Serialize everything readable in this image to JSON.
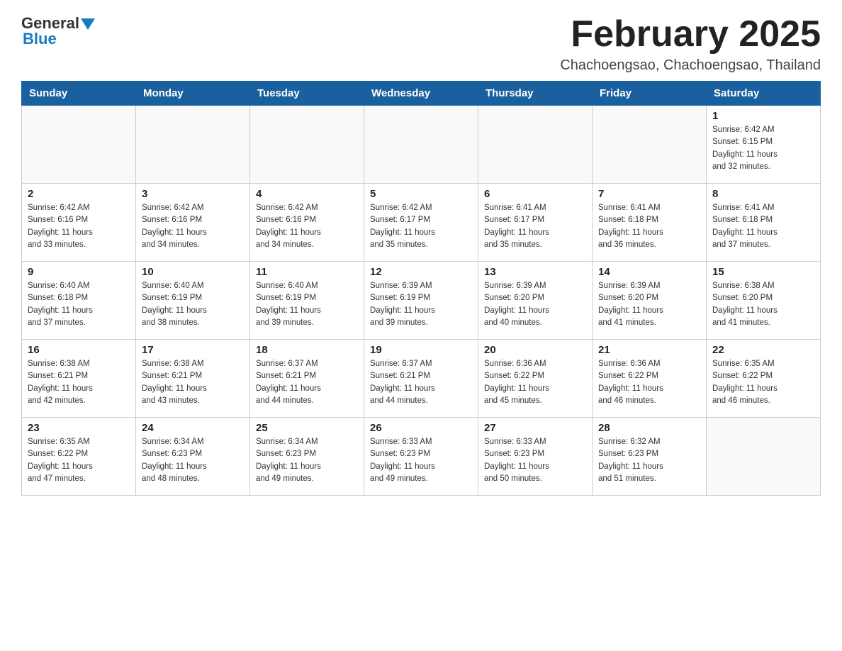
{
  "header": {
    "logo_general": "General",
    "logo_blue": "Blue",
    "month_title": "February 2025",
    "location": "Chachoengsao, Chachoengsao, Thailand"
  },
  "days_of_week": [
    "Sunday",
    "Monday",
    "Tuesday",
    "Wednesday",
    "Thursday",
    "Friday",
    "Saturday"
  ],
  "weeks": [
    [
      {
        "day": "",
        "info": ""
      },
      {
        "day": "",
        "info": ""
      },
      {
        "day": "",
        "info": ""
      },
      {
        "day": "",
        "info": ""
      },
      {
        "day": "",
        "info": ""
      },
      {
        "day": "",
        "info": ""
      },
      {
        "day": "1",
        "info": "Sunrise: 6:42 AM\nSunset: 6:15 PM\nDaylight: 11 hours\nand 32 minutes."
      }
    ],
    [
      {
        "day": "2",
        "info": "Sunrise: 6:42 AM\nSunset: 6:16 PM\nDaylight: 11 hours\nand 33 minutes."
      },
      {
        "day": "3",
        "info": "Sunrise: 6:42 AM\nSunset: 6:16 PM\nDaylight: 11 hours\nand 34 minutes."
      },
      {
        "day": "4",
        "info": "Sunrise: 6:42 AM\nSunset: 6:16 PM\nDaylight: 11 hours\nand 34 minutes."
      },
      {
        "day": "5",
        "info": "Sunrise: 6:42 AM\nSunset: 6:17 PM\nDaylight: 11 hours\nand 35 minutes."
      },
      {
        "day": "6",
        "info": "Sunrise: 6:41 AM\nSunset: 6:17 PM\nDaylight: 11 hours\nand 35 minutes."
      },
      {
        "day": "7",
        "info": "Sunrise: 6:41 AM\nSunset: 6:18 PM\nDaylight: 11 hours\nand 36 minutes."
      },
      {
        "day": "8",
        "info": "Sunrise: 6:41 AM\nSunset: 6:18 PM\nDaylight: 11 hours\nand 37 minutes."
      }
    ],
    [
      {
        "day": "9",
        "info": "Sunrise: 6:40 AM\nSunset: 6:18 PM\nDaylight: 11 hours\nand 37 minutes."
      },
      {
        "day": "10",
        "info": "Sunrise: 6:40 AM\nSunset: 6:19 PM\nDaylight: 11 hours\nand 38 minutes."
      },
      {
        "day": "11",
        "info": "Sunrise: 6:40 AM\nSunset: 6:19 PM\nDaylight: 11 hours\nand 39 minutes."
      },
      {
        "day": "12",
        "info": "Sunrise: 6:39 AM\nSunset: 6:19 PM\nDaylight: 11 hours\nand 39 minutes."
      },
      {
        "day": "13",
        "info": "Sunrise: 6:39 AM\nSunset: 6:20 PM\nDaylight: 11 hours\nand 40 minutes."
      },
      {
        "day": "14",
        "info": "Sunrise: 6:39 AM\nSunset: 6:20 PM\nDaylight: 11 hours\nand 41 minutes."
      },
      {
        "day": "15",
        "info": "Sunrise: 6:38 AM\nSunset: 6:20 PM\nDaylight: 11 hours\nand 41 minutes."
      }
    ],
    [
      {
        "day": "16",
        "info": "Sunrise: 6:38 AM\nSunset: 6:21 PM\nDaylight: 11 hours\nand 42 minutes."
      },
      {
        "day": "17",
        "info": "Sunrise: 6:38 AM\nSunset: 6:21 PM\nDaylight: 11 hours\nand 43 minutes."
      },
      {
        "day": "18",
        "info": "Sunrise: 6:37 AM\nSunset: 6:21 PM\nDaylight: 11 hours\nand 44 minutes."
      },
      {
        "day": "19",
        "info": "Sunrise: 6:37 AM\nSunset: 6:21 PM\nDaylight: 11 hours\nand 44 minutes."
      },
      {
        "day": "20",
        "info": "Sunrise: 6:36 AM\nSunset: 6:22 PM\nDaylight: 11 hours\nand 45 minutes."
      },
      {
        "day": "21",
        "info": "Sunrise: 6:36 AM\nSunset: 6:22 PM\nDaylight: 11 hours\nand 46 minutes."
      },
      {
        "day": "22",
        "info": "Sunrise: 6:35 AM\nSunset: 6:22 PM\nDaylight: 11 hours\nand 46 minutes."
      }
    ],
    [
      {
        "day": "23",
        "info": "Sunrise: 6:35 AM\nSunset: 6:22 PM\nDaylight: 11 hours\nand 47 minutes."
      },
      {
        "day": "24",
        "info": "Sunrise: 6:34 AM\nSunset: 6:23 PM\nDaylight: 11 hours\nand 48 minutes."
      },
      {
        "day": "25",
        "info": "Sunrise: 6:34 AM\nSunset: 6:23 PM\nDaylight: 11 hours\nand 49 minutes."
      },
      {
        "day": "26",
        "info": "Sunrise: 6:33 AM\nSunset: 6:23 PM\nDaylight: 11 hours\nand 49 minutes."
      },
      {
        "day": "27",
        "info": "Sunrise: 6:33 AM\nSunset: 6:23 PM\nDaylight: 11 hours\nand 50 minutes."
      },
      {
        "day": "28",
        "info": "Sunrise: 6:32 AM\nSunset: 6:23 PM\nDaylight: 11 hours\nand 51 minutes."
      },
      {
        "day": "",
        "info": ""
      }
    ]
  ]
}
